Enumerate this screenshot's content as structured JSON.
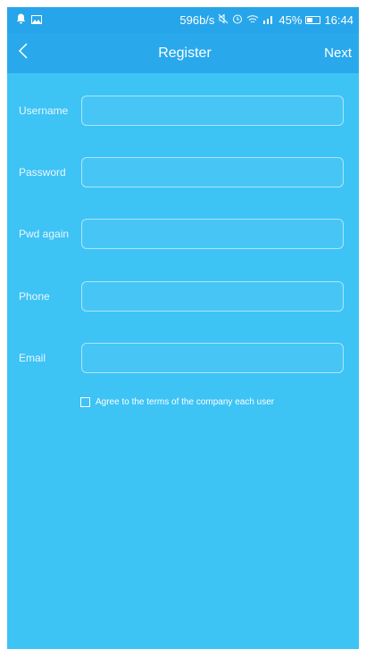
{
  "status_bar": {
    "speed": "596b/s",
    "battery": "45%",
    "time": "16:44",
    "icons": [
      "notification-icon",
      "image-icon",
      "mute-icon",
      "alarm-icon",
      "wifi-icon",
      "signal-icon"
    ],
    "battery_level": 0.45
  },
  "nav": {
    "back_icon": "chevron-left-icon",
    "title": "Register",
    "next_label": "Next"
  },
  "form": {
    "fields": [
      {
        "label": "Username",
        "value": ""
      },
      {
        "label": "Password",
        "value": ""
      },
      {
        "label": "Pwd again",
        "value": ""
      },
      {
        "label": "Phone",
        "value": ""
      },
      {
        "label": "Email",
        "value": ""
      }
    ],
    "agree_text": "Agree to the terms of the company each user",
    "agree_checked": false
  },
  "colors": {
    "background": "#3ec3f5",
    "navbar": "#29a9ec",
    "statusbar": "#27a5ea"
  }
}
